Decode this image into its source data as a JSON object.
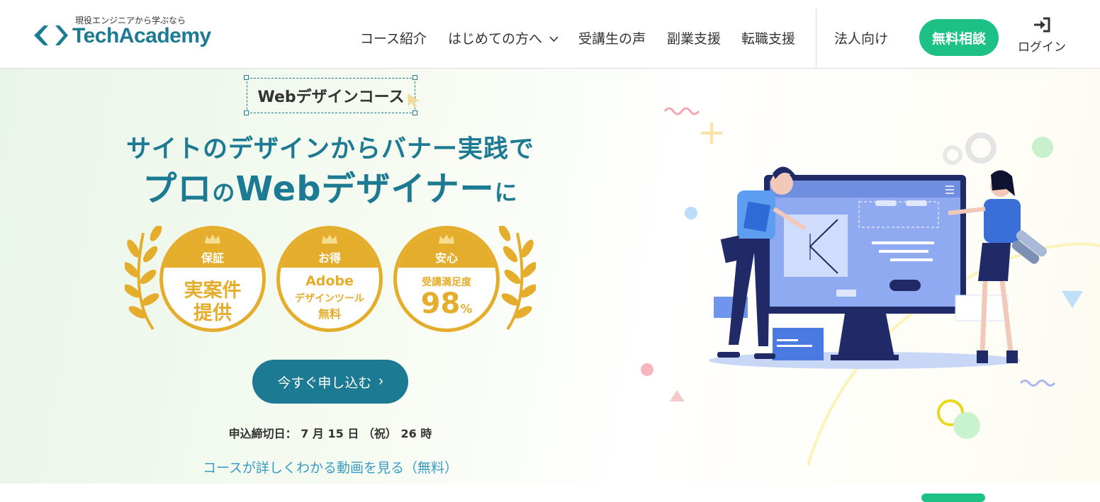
{
  "header": {
    "logo_sub": "現役エンジニアから学ぶなら",
    "logo_text": "TechAcademy",
    "nav": [
      {
        "label": "コース紹介"
      },
      {
        "label": "はじめての方へ"
      },
      {
        "label": "受講生の声"
      },
      {
        "label": "副業支援"
      },
      {
        "label": "転職支援"
      },
      {
        "label": "法人向け"
      }
    ],
    "cta_label": "無料相談",
    "login_label": "ログイン",
    "cta_color": "#1dc185"
  },
  "hero": {
    "course_tag": "Webデザインコース",
    "headline_line1": "サイトのデザインからバナー実践で",
    "headline_line2_a": "プロ",
    "headline_line2_b": "の",
    "headline_line2_c": "Webデザイナー",
    "headline_line2_d": "に",
    "badges": [
      {
        "label": "保証",
        "main1": "実案件",
        "main2": "提供"
      },
      {
        "label": "お得",
        "main1": "Adobe",
        "main2": "デザインツール",
        "main3": "無料"
      },
      {
        "label": "安心",
        "main1": "受講満足度",
        "main2": "98",
        "unit": "%"
      }
    ],
    "apply_label": "今すぐ申し込む",
    "deadline": "申込締切日： 7 月 15 日 （祝） 26 時",
    "video_link": "コースが詳しくわかる動画を見る（無料）",
    "brand_color": "#1d7a93",
    "badge_color": "#e5ad2c"
  }
}
